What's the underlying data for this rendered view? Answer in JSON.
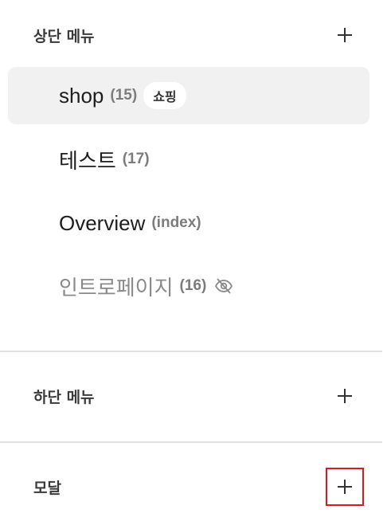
{
  "top_menu": {
    "title": "상단 메뉴",
    "add_icon": "plus-icon",
    "items": [
      {
        "name": "shop",
        "count": "(15)",
        "tag": "쇼핑",
        "active": true,
        "hidden": false
      },
      {
        "name": "테스트",
        "count": "(17)",
        "active": false,
        "hidden": false
      },
      {
        "name": "Overview",
        "count": "(index)",
        "active": false,
        "hidden": false
      },
      {
        "name": "인트로페이지",
        "count": "(16)",
        "active": false,
        "hidden": true,
        "status_icon": "eye-off-icon"
      }
    ]
  },
  "bottom_menu": {
    "title": "하단 메뉴",
    "add_icon": "plus-icon"
  },
  "modal": {
    "title": "모달",
    "add_icon": "plus-icon"
  },
  "colors": {
    "active_bg": "#f1f1f1",
    "highlight_border": "#e0161d",
    "muted_text": "#8a8a8a"
  }
}
